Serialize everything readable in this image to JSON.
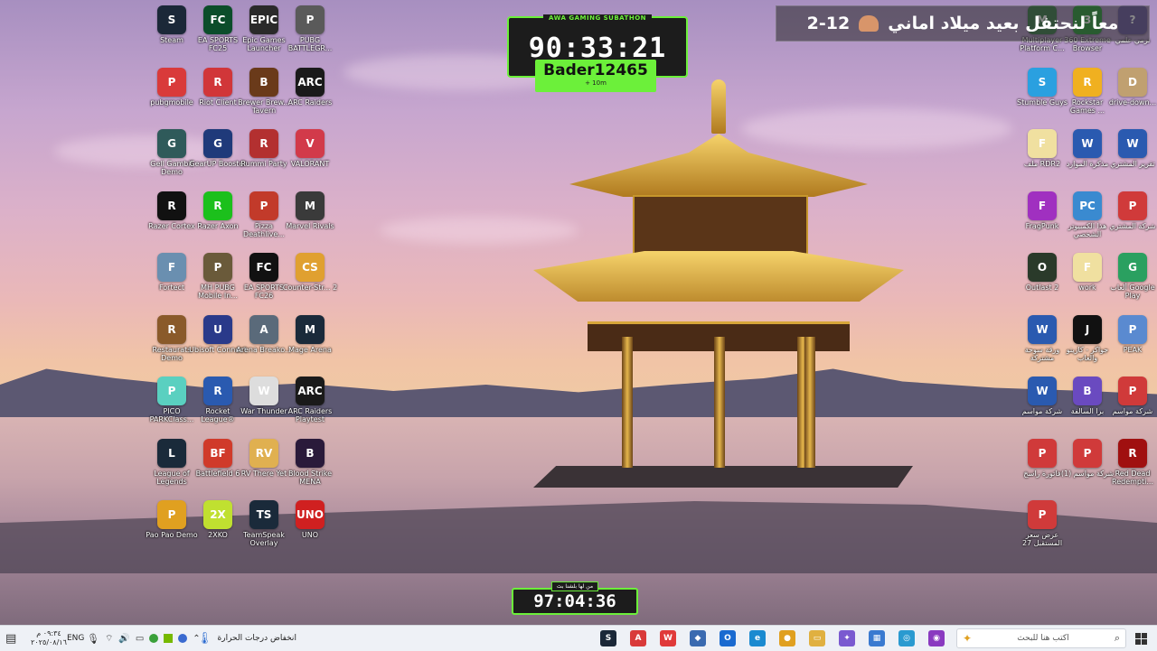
{
  "overlays": {
    "subathon_caption": "AWA GAMING SUBATHON",
    "subathon_timer": "90:33:21",
    "sub_user": "Bader12465",
    "sub_user_added": "+ 10m",
    "countdown_caption": "من لها بلشنا بث",
    "countdown_timer": "97:04:36",
    "banner_text": "معاً لنحتفل بعيد ميلاد اماني",
    "banner_date": "2-12"
  },
  "desktop_icons_left": [
    {
      "label": "Steam",
      "color": "#1b2838",
      "glyph": "S"
    },
    {
      "label": "EA SPORTS FC25",
      "color": "#0b4d2a",
      "glyph": "FC"
    },
    {
      "label": "Epic Games Launcher",
      "color": "#2a2a2a",
      "glyph": "EPIC"
    },
    {
      "label": "PUBG BATTLEGR...",
      "color": "#5a5a5a",
      "glyph": "P"
    },
    {
      "label": "pubgmobile",
      "color": "#d93a3a",
      "glyph": "P"
    },
    {
      "label": "Riot Client",
      "color": "#d13639",
      "glyph": "R"
    },
    {
      "label": "Brewer Brew... Tavern",
      "color": "#6a3a1a",
      "glyph": "B"
    },
    {
      "label": "ARC Raiders",
      "color": "#1a1a1a",
      "glyph": "ARC"
    },
    {
      "label": "Gell Gambit Demo",
      "color": "#2f5a5a",
      "glyph": "G"
    },
    {
      "label": "GearUP Booster",
      "color": "#1f3a7a",
      "glyph": "G"
    },
    {
      "label": "Rummi Party",
      "color": "#b33030",
      "glyph": "R"
    },
    {
      "label": "VALORANT",
      "color": "#d23a4a",
      "glyph": "V"
    },
    {
      "label": "Razer Cortex",
      "color": "#111",
      "glyph": "R"
    },
    {
      "label": "Razer Axon",
      "color": "#1cc01c",
      "glyph": "R"
    },
    {
      "label": "Pizza Deathlive...",
      "color": "#c23a2a",
      "glyph": "P"
    },
    {
      "label": "Marvel Rivals",
      "color": "#3a3a3a",
      "glyph": "M"
    },
    {
      "label": "Fortect",
      "color": "#6a8fb0",
      "glyph": "F"
    },
    {
      "label": "MH PUBG Mobile In...",
      "color": "#6a5a3a",
      "glyph": "P"
    },
    {
      "label": "EA SPORTS FC26",
      "color": "#111",
      "glyph": "FC"
    },
    {
      "label": "Counter-Str... 2",
      "color": "#e0a030",
      "glyph": "CS"
    },
    {
      "label": "Restaurats Demo",
      "color": "#8a5a2a",
      "glyph": "R"
    },
    {
      "label": "Ubisoft Connect",
      "color": "#2a3a8a",
      "glyph": "U"
    },
    {
      "label": "Arena Breako...",
      "color": "#5a6a7a",
      "glyph": "A"
    },
    {
      "label": "Mage Arena",
      "color": "#1a2a3a",
      "glyph": "M"
    },
    {
      "label": "PICO PARKClass...",
      "color": "#5ad0c0",
      "glyph": "P"
    },
    {
      "label": "Rocket League®",
      "color": "#2a5ab0",
      "glyph": "R"
    },
    {
      "label": "War Thunder",
      "color": "#ddd",
      "glyph": "W"
    },
    {
      "label": "ARC Raiders Playtest",
      "color": "#1a1a1a",
      "glyph": "ARC"
    },
    {
      "label": "League of Legends",
      "color": "#1a2a3a",
      "glyph": "L"
    },
    {
      "label": "Battlefield 6",
      "color": "#d03a2a",
      "glyph": "BF"
    },
    {
      "label": "RV There Yet",
      "color": "#e0b050",
      "glyph": "RV"
    },
    {
      "label": "Blood Strike MENA",
      "color": "#2a1a3a",
      "glyph": "B"
    },
    {
      "label": "Pao Pao Demo",
      "color": "#e0a020",
      "glyph": "P"
    },
    {
      "label": "2XKO",
      "color": "#c0e030",
      "glyph": "2X"
    },
    {
      "label": "TeamSpeak Overlay",
      "color": "#1a2a3a",
      "glyph": "TS"
    },
    {
      "label": "UNO",
      "color": "#d02020",
      "glyph": "UNO"
    }
  ],
  "desktop_icons_right": [
    {
      "label": "Multiplayer Platform C...",
      "color": "#3a7a4a",
      "glyph": "M"
    },
    {
      "label": "360 Extreme Browser",
      "color": "#2a9a3a",
      "glyph": "3"
    },
    {
      "label": "نرمي علمي",
      "color": "#6a5aa0",
      "glyph": "?"
    },
    {
      "label": "Stumble Guys",
      "color": "#2aa0e0",
      "glyph": "S"
    },
    {
      "label": "Rockstar Games ...",
      "color": "#f0b020",
      "glyph": "R"
    },
    {
      "label": "drive-down...",
      "color": "#c0a070",
      "glyph": "D"
    },
    {
      "label": "ملف RDR2",
      "color": "#f0e0a0",
      "glyph": "F"
    },
    {
      "label": "مذكرة الموارد",
      "color": "#2a5ab0",
      "glyph": "W"
    },
    {
      "label": "تقرير المشتري",
      "color": "#2a5ab0",
      "glyph": "W"
    },
    {
      "label": "FragPunk",
      "color": "#a030c0",
      "glyph": "F"
    },
    {
      "label": "هذا الكمبيوتر الشخصي",
      "color": "#3a8ad0",
      "glyph": "PC"
    },
    {
      "label": "شركة المشتري",
      "color": "#d03a3a",
      "glyph": "P"
    },
    {
      "label": "Outlast 2",
      "color": "#2a3a2a",
      "glyph": "O"
    },
    {
      "label": "work",
      "color": "#f0e0a0",
      "glyph": "F"
    },
    {
      "label": "ألعاب Google Play",
      "color": "#2aa060",
      "glyph": "G"
    },
    {
      "label": "ورقة سوحة مشتركة",
      "color": "#2a5ab0",
      "glyph": "W"
    },
    {
      "label": "جواكر - كازينو والعاب",
      "color": "#111",
      "glyph": "J"
    },
    {
      "label": "PEAK",
      "color": "#5a8ad0",
      "glyph": "P"
    },
    {
      "label": "شركة مواسم",
      "color": "#2a5ab0",
      "glyph": "W"
    },
    {
      "label": "برا السالفة",
      "color": "#6a4ac0",
      "glyph": "B"
    },
    {
      "label": "شركة مواسم",
      "color": "#d03a3a",
      "glyph": "P"
    },
    {
      "label": "فاتورة راسخ",
      "color": "#d03a3a",
      "glyph": "P"
    },
    {
      "label": "شركة مواسم (1)",
      "color": "#d03a3a",
      "glyph": "P"
    },
    {
      "label": "Red Dead Redempti...",
      "color": "#a01010",
      "glyph": "R"
    },
    {
      "label": "عرض سعر المستقبل 27",
      "color": "#d03a3a",
      "glyph": "P"
    }
  ],
  "taskbar": {
    "clock_time": "٠٩:٣٤ م",
    "clock_date": "٢٠٢٥/٠٨/١٦",
    "language": "ENG",
    "weather": "انخفاض درجات الحرارة",
    "search_placeholder": "اكتب هنا للبحث",
    "apps": [
      {
        "name": "steam",
        "color": "#1b2838",
        "glyph": "S"
      },
      {
        "name": "anydesk",
        "color": "#d93a3a",
        "glyph": "A"
      },
      {
        "name": "wps",
        "color": "#e03a3a",
        "glyph": "W"
      },
      {
        "name": "app-blue",
        "color": "#3a6ab0",
        "glyph": "◆"
      },
      {
        "name": "outlook",
        "color": "#1a6ad0",
        "glyph": "O"
      },
      {
        "name": "edge",
        "color": "#1a8ad0",
        "glyph": "e"
      },
      {
        "name": "chrome",
        "color": "#e0a020",
        "glyph": "●"
      },
      {
        "name": "file-explorer",
        "color": "#e0b040",
        "glyph": "▭"
      },
      {
        "name": "copilot",
        "color": "#7a5ad0",
        "glyph": "✦"
      },
      {
        "name": "microsoft-store",
        "color": "#3a7ad0",
        "glyph": "▦"
      },
      {
        "name": "app-cyan",
        "color": "#2a9ad0",
        "glyph": "◎"
      },
      {
        "name": "app-purple",
        "color": "#8a3ac0",
        "glyph": "◉"
      }
    ]
  }
}
